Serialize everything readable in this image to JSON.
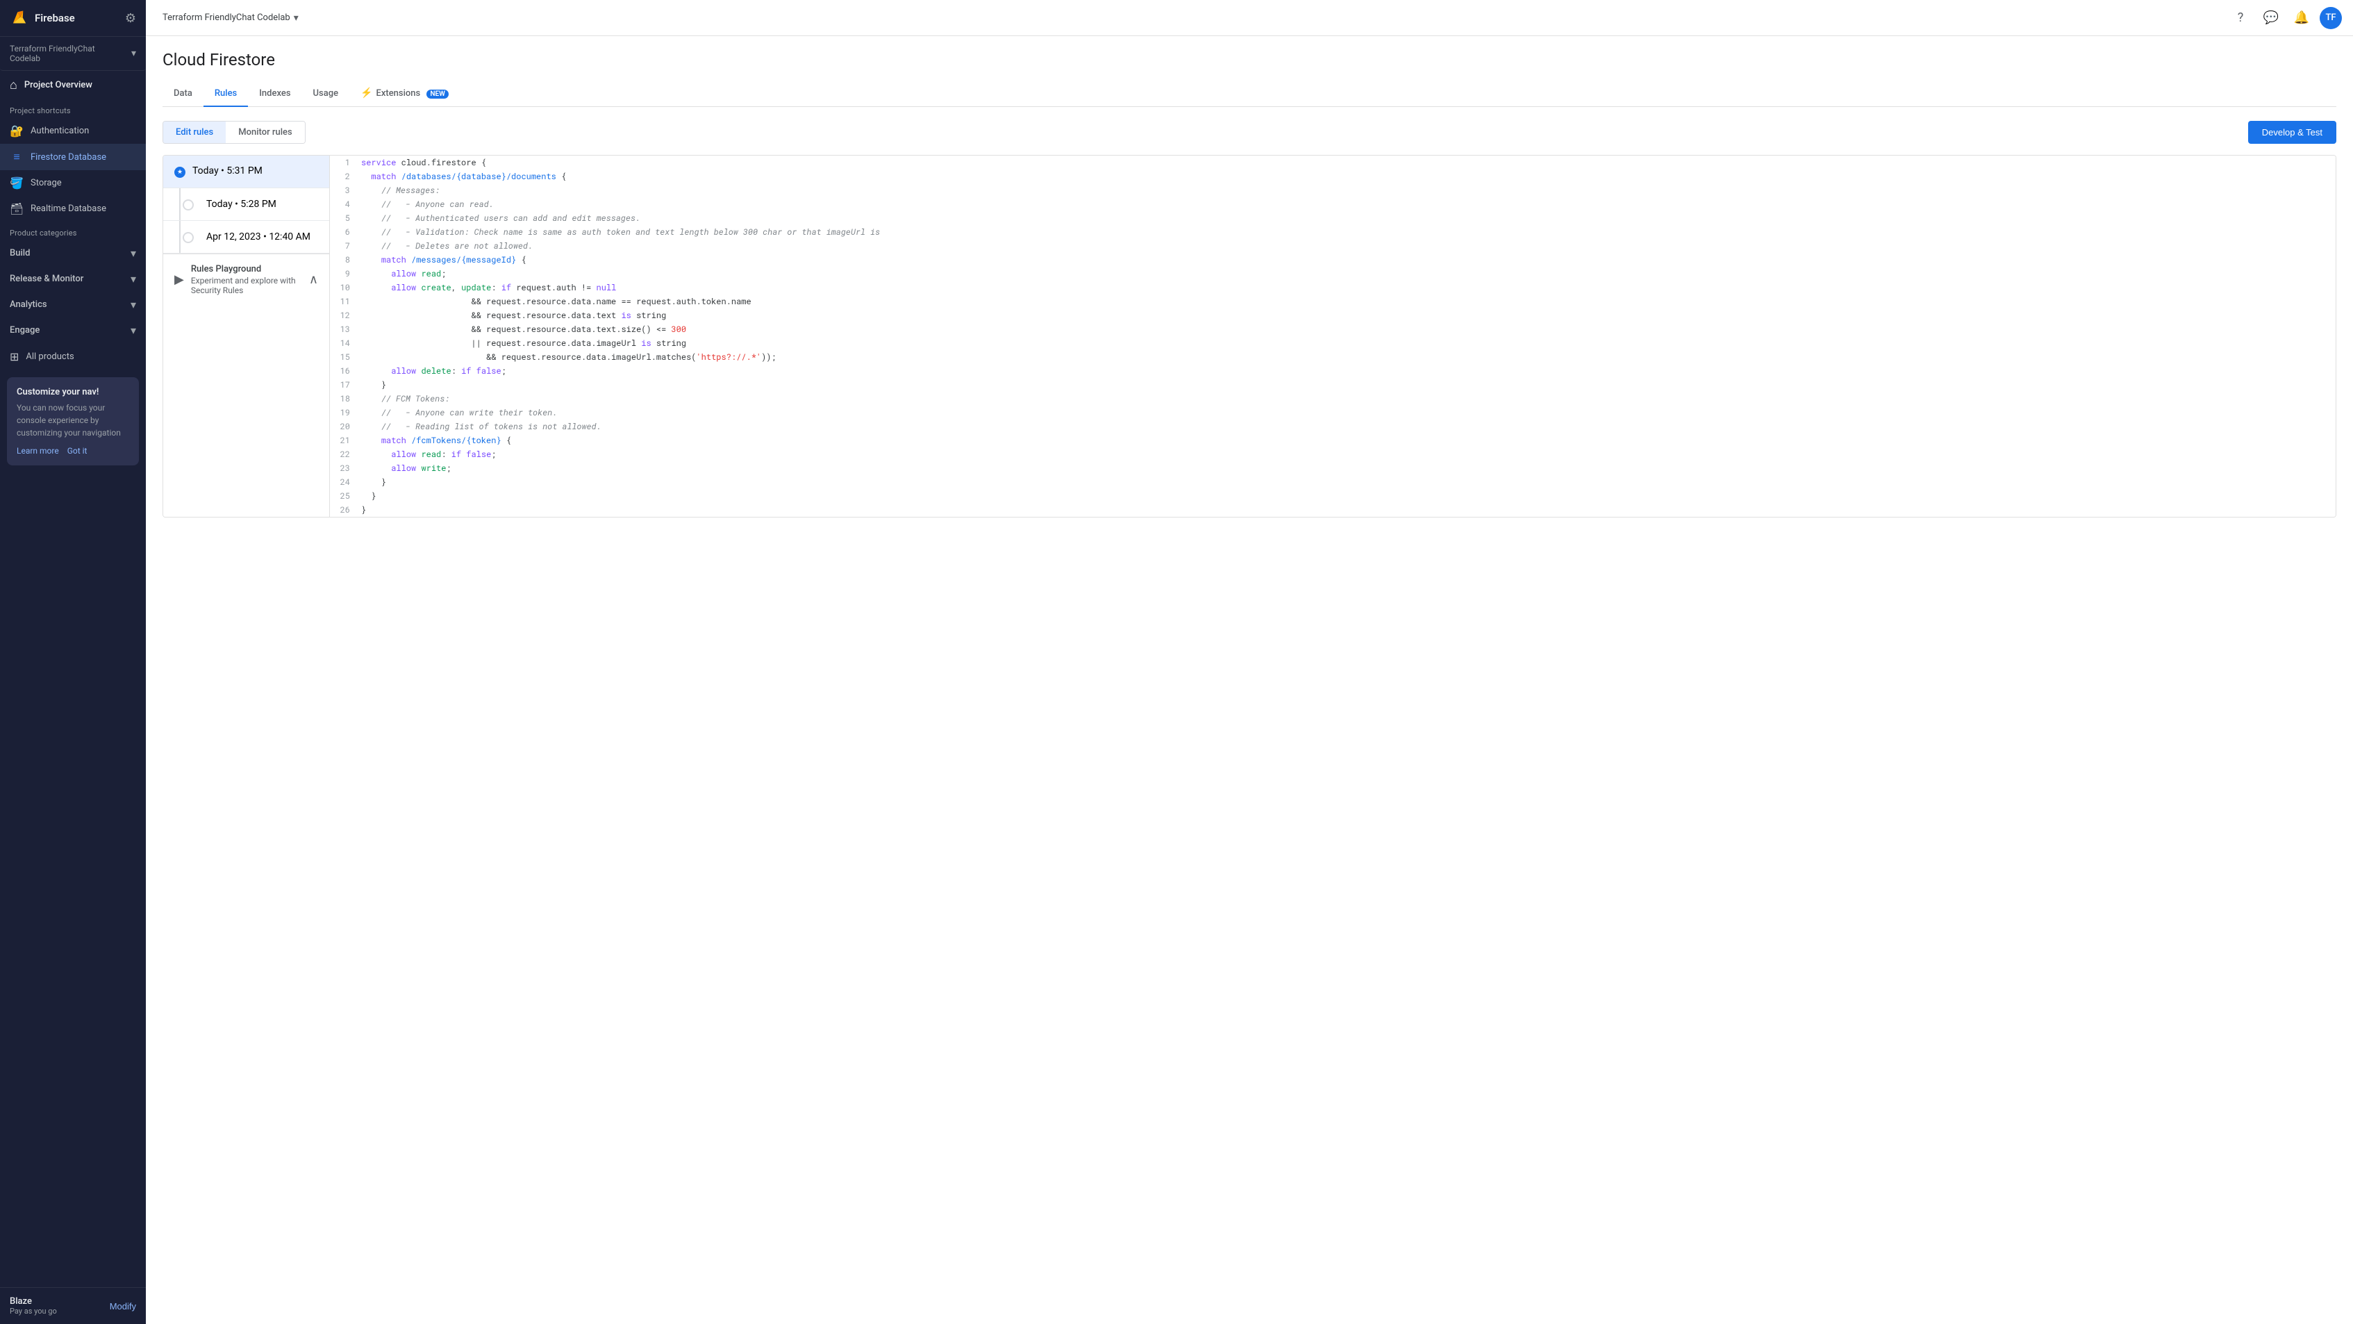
{
  "sidebar": {
    "project_name": "Terraform FriendlyChat Codelab",
    "project_overview_label": "Project Overview",
    "section_shortcuts": "Project shortcuts",
    "section_categories": "Product categories",
    "items": [
      {
        "id": "authentication",
        "label": "Authentication",
        "icon": "🔐"
      },
      {
        "id": "firestore",
        "label": "Firestore Database",
        "icon": "🗄️"
      },
      {
        "id": "storage",
        "label": "Storage",
        "icon": "📦"
      },
      {
        "id": "realtime-db",
        "label": "Realtime Database",
        "icon": "💾"
      }
    ],
    "categories": [
      {
        "id": "build",
        "label": "Build"
      },
      {
        "id": "release",
        "label": "Release & Monitor"
      },
      {
        "id": "analytics",
        "label": "Analytics"
      },
      {
        "id": "engage",
        "label": "Engage"
      }
    ],
    "all_products": "All products",
    "customize_title": "Customize your nav!",
    "customize_body": "You can now focus your console experience by customizing your navigation",
    "learn_more": "Learn more",
    "got_it": "Got it",
    "plan_name": "Blaze",
    "plan_sub": "Pay as you go",
    "modify_label": "Modify"
  },
  "topbar": {
    "project_selector": "Terraform FriendlyChat Codelab",
    "help_icon": "?",
    "chat_icon": "💬",
    "notif_icon": "🔔",
    "avatar_initials": "TF"
  },
  "page": {
    "title": "Cloud Firestore",
    "tabs": [
      {
        "id": "data",
        "label": "Data"
      },
      {
        "id": "rules",
        "label": "Rules",
        "active": true
      },
      {
        "id": "indexes",
        "label": "Indexes"
      },
      {
        "id": "usage",
        "label": "Usage"
      },
      {
        "id": "extensions",
        "label": "Extensions",
        "badge": "NEW",
        "icon": "⚡"
      }
    ]
  },
  "rules_editor": {
    "edit_rules_label": "Edit rules",
    "monitor_rules_label": "Monitor rules",
    "develop_test_label": "Develop & Test",
    "history": [
      {
        "id": "h1",
        "label": "Today • 5:31 PM",
        "active": true
      },
      {
        "id": "h2",
        "label": "Today • 5:28 PM"
      },
      {
        "id": "h3",
        "label": "Apr 12, 2023 • 12:40 AM"
      }
    ],
    "playground": {
      "title": "Rules Playground",
      "subtitle": "Experiment and explore with Security Rules"
    },
    "code_lines": [
      {
        "num": 1,
        "content": "service cloud.firestore {"
      },
      {
        "num": 2,
        "content": "  match /databases/{database}/documents {"
      },
      {
        "num": 3,
        "content": "    // Messages:"
      },
      {
        "num": 4,
        "content": "    //   - Anyone can read."
      },
      {
        "num": 5,
        "content": "    //   - Authenticated users can add and edit messages."
      },
      {
        "num": 6,
        "content": "    //   - Validation: Check name is same as auth token and text length below 300 char or that imageUrl is"
      },
      {
        "num": 7,
        "content": "    //   - Deletes are not allowed."
      },
      {
        "num": 8,
        "content": "    match /messages/{messageId} {"
      },
      {
        "num": 9,
        "content": "      allow read;"
      },
      {
        "num": 10,
        "content": "      allow create, update: if request.auth != null"
      },
      {
        "num": 11,
        "content": "                        && request.resource.data.name == request.auth.token.name"
      },
      {
        "num": 12,
        "content": "                        && request.resource.data.text is string"
      },
      {
        "num": 13,
        "content": "                        && request.resource.data.text.size() <= 300"
      },
      {
        "num": 14,
        "content": "                        || request.resource.data.imageUrl is string"
      },
      {
        "num": 15,
        "content": "                           && request.resource.data.imageUrl.matches('https?://.*'));"
      },
      {
        "num": 16,
        "content": "      allow delete: if false;"
      },
      {
        "num": 17,
        "content": "    }"
      },
      {
        "num": 18,
        "content": "    // FCM Tokens:"
      },
      {
        "num": 19,
        "content": "    //   - Anyone can write their token."
      },
      {
        "num": 20,
        "content": "    //   - Reading list of tokens is not allowed."
      },
      {
        "num": 21,
        "content": "    match /fcmTokens/{token} {"
      },
      {
        "num": 22,
        "content": "      allow read: if false;"
      },
      {
        "num": 23,
        "content": "      allow write;"
      },
      {
        "num": 24,
        "content": "    }"
      },
      {
        "num": 25,
        "content": "  }"
      },
      {
        "num": 26,
        "content": "}"
      }
    ]
  }
}
